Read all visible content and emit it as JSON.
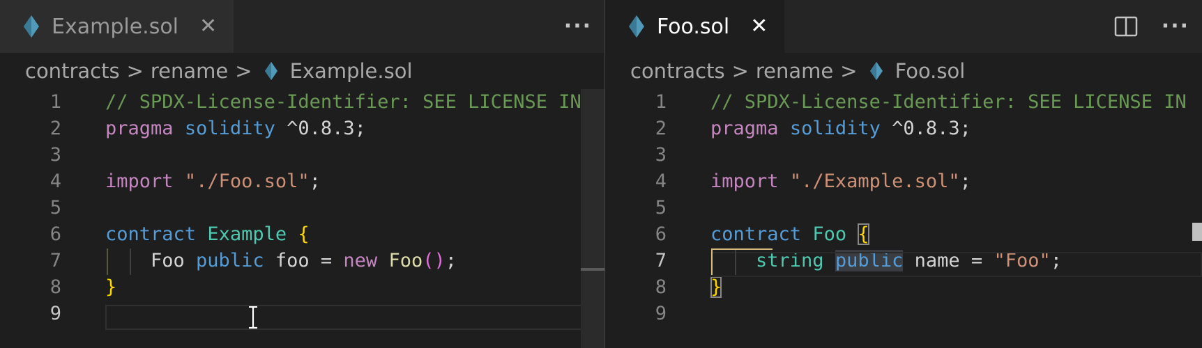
{
  "left_pane": {
    "tab": {
      "filename": "Example.sol"
    },
    "more_actions": "···",
    "breadcrumb": {
      "folder1": "contracts",
      "folder2": "rename",
      "file": "Example.sol",
      "sep": ">"
    },
    "lines": [
      {
        "n": "1",
        "tokens": [
          [
            "c-comment",
            "// SPDX-License-Identifier: SEE LICENSE IN"
          ]
        ]
      },
      {
        "n": "2",
        "tokens": [
          [
            "c-kw",
            "pragma"
          ],
          [
            "c-plain",
            " "
          ],
          [
            "c-kw2",
            "solidity"
          ],
          [
            "c-plain",
            " ^0.8.3;"
          ]
        ]
      },
      {
        "n": "3",
        "tokens": []
      },
      {
        "n": "4",
        "tokens": [
          [
            "c-kw",
            "import"
          ],
          [
            "c-plain",
            " "
          ],
          [
            "c-str",
            "\"./Foo.sol\""
          ],
          [
            "c-plain",
            ";"
          ]
        ]
      },
      {
        "n": "5",
        "tokens": []
      },
      {
        "n": "6",
        "tokens": [
          [
            "c-kw2",
            "contract"
          ],
          [
            "c-plain",
            " "
          ],
          [
            "c-type",
            "Example"
          ],
          [
            "c-plain",
            " "
          ],
          [
            "c-bracket",
            "{"
          ]
        ]
      },
      {
        "n": "7",
        "tokens": [
          [
            "c-plain",
            "    Foo "
          ],
          [
            "c-kw2",
            "public"
          ],
          [
            "c-plain",
            " foo = "
          ],
          [
            "c-kw",
            "new"
          ],
          [
            "c-plain",
            " "
          ],
          [
            "c-fn",
            "Foo"
          ],
          [
            "c-paren",
            "()"
          ],
          [
            "c-plain",
            ";"
          ]
        ]
      },
      {
        "n": "8",
        "tokens": [
          [
            "c-bracket",
            "}"
          ]
        ]
      },
      {
        "n": "9",
        "tokens": []
      }
    ]
  },
  "right_pane": {
    "tab": {
      "filename": "Foo.sol"
    },
    "more_actions": "···",
    "breadcrumb": {
      "folder1": "contracts",
      "folder2": "rename",
      "file": "Foo.sol",
      "sep": ">"
    },
    "lines": [
      {
        "n": "1",
        "tokens": [
          [
            "c-comment",
            "// SPDX-License-Identifier: SEE LICENSE IN"
          ]
        ]
      },
      {
        "n": "2",
        "tokens": [
          [
            "c-kw",
            "pragma"
          ],
          [
            "c-plain",
            " "
          ],
          [
            "c-kw2",
            "solidity"
          ],
          [
            "c-plain",
            " ^0.8.3;"
          ]
        ]
      },
      {
        "n": "3",
        "tokens": []
      },
      {
        "n": "4",
        "tokens": [
          [
            "c-kw",
            "import"
          ],
          [
            "c-plain",
            " "
          ],
          [
            "c-str",
            "\"./Example.sol\""
          ],
          [
            "c-plain",
            ";"
          ]
        ]
      },
      {
        "n": "5",
        "tokens": []
      },
      {
        "n": "6",
        "tokens": [
          [
            "c-kw2",
            "contract"
          ],
          [
            "c-plain",
            " "
          ],
          [
            "c-type",
            "Foo"
          ],
          [
            "c-plain",
            " "
          ],
          [
            "c-bracket bracket-match",
            "{"
          ]
        ]
      },
      {
        "n": "7",
        "tokens": [
          [
            "c-plain",
            "    "
          ],
          [
            "c-type",
            "string"
          ],
          [
            "c-plain",
            " "
          ],
          [
            "c-kw2 word-hl",
            "public"
          ],
          [
            "c-plain",
            " name = "
          ],
          [
            "c-str",
            "\"Foo\""
          ],
          [
            "c-plain",
            ";"
          ]
        ]
      },
      {
        "n": "8",
        "tokens": [
          [
            "c-bracket bracket-match",
            "}"
          ]
        ]
      },
      {
        "n": "9",
        "tokens": []
      }
    ]
  },
  "colors": {
    "accent_solidity_icon": "#519aba",
    "editor_bg": "#1e1e1e",
    "tabbar_bg": "#252526"
  }
}
